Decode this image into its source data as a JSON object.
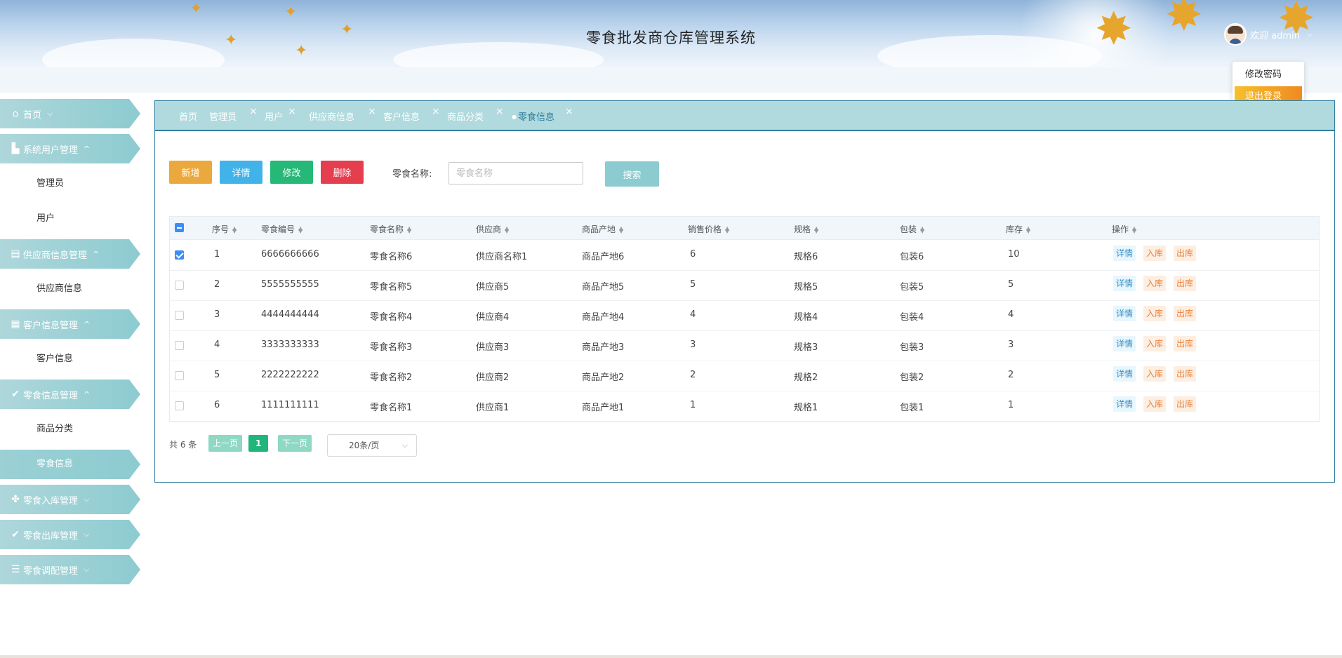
{
  "header": {
    "title": "零食批发商仓库管理系统",
    "welcome": "欢迎 admin"
  },
  "user_menu": {
    "change_password": "修改密码",
    "logout": "退出登录"
  },
  "sidebar": {
    "home": "首页",
    "groups": [
      {
        "label": "系统用户管理",
        "icon": "building-icon",
        "items": [
          "管理员",
          "用户"
        ]
      },
      {
        "label": "供应商信息管理",
        "icon": "folder-icon",
        "items": [
          "供应商信息"
        ]
      },
      {
        "label": "客户信息管理",
        "icon": "dashboard-icon",
        "items": [
          "客户信息"
        ]
      },
      {
        "label": "零食信息管理",
        "icon": "check-circle-icon",
        "items": [
          "商品分类",
          "零食信息"
        ]
      },
      {
        "label": "零食入库管理",
        "icon": "apps-icon",
        "items": []
      },
      {
        "label": "零食出库管理",
        "icon": "check-circle-icon",
        "items": []
      },
      {
        "label": "零食调配管理",
        "icon": "list-icon",
        "items": []
      }
    ],
    "active_item": "零食信息"
  },
  "tabs": [
    "首页",
    "管理员",
    "用户",
    "供应商信息",
    "客户信息",
    "商品分类",
    "零食信息"
  ],
  "toolbar": {
    "add": "新增",
    "detail": "详情",
    "edit": "修改",
    "delete": "删除",
    "search_label": "零食名称:",
    "search_placeholder": "零食名称",
    "search_button": "搜索"
  },
  "table": {
    "columns": [
      "序号",
      "零食编号",
      "零食名称",
      "供应商",
      "商品产地",
      "销售价格",
      "规格",
      "包装",
      "库存",
      "操作"
    ],
    "rows": [
      [
        "1",
        "6666666666",
        "零食名称6",
        "供应商名称1",
        "商品产地6",
        "6",
        "规格6",
        "包装6",
        "10"
      ],
      [
        "2",
        "5555555555",
        "零食名称5",
        "供应商5",
        "商品产地5",
        "5",
        "规格5",
        "包装5",
        "5"
      ],
      [
        "3",
        "4444444444",
        "零食名称4",
        "供应商4",
        "商品产地4",
        "4",
        "规格4",
        "包装4",
        "4"
      ],
      [
        "4",
        "3333333333",
        "零食名称3",
        "供应商3",
        "商品产地3",
        "3",
        "规格3",
        "包装3",
        "3"
      ],
      [
        "5",
        "2222222222",
        "零食名称2",
        "供应商2",
        "商品产地2",
        "2",
        "规格2",
        "包装2",
        "2"
      ],
      [
        "6",
        "1111111111",
        "零食名称1",
        "供应商1",
        "商品产地1",
        "1",
        "规格1",
        "包装1",
        "1"
      ]
    ],
    "checked_row": 0,
    "actions": {
      "detail": "详情",
      "in": "入库",
      "out": "出库"
    }
  },
  "pagination": {
    "total": "共 6 条",
    "prev": "上一页",
    "page": "1",
    "next": "下一页",
    "page_size": "20条/页"
  },
  "colors": {
    "accent_teal": "#8ccbd0",
    "border_blue": "#2f7e9e",
    "add": "#eba83d",
    "detail": "#42b3e8",
    "edit": "#25b876",
    "delete": "#e53e4f"
  }
}
